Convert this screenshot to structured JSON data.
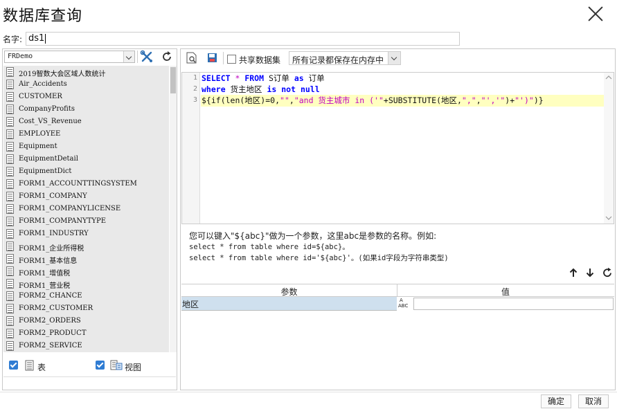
{
  "dialog": {
    "title": "数据库查询"
  },
  "name_field": {
    "label": "名字:",
    "value": "ds1"
  },
  "connection": {
    "selected": "FRDemo"
  },
  "tables": [
    "2019智数大会区域人数统计",
    "Air_Accidents",
    "CUSTOMER",
    "CompanyProfits",
    "Cost_VS_Revenue",
    "EMPLOYEE",
    "Equipment",
    "EquipmentDetail",
    "EquipmentDict",
    "FORM1_ACCOUNTTINGSYSTEM",
    "FORM1_COMPANY",
    "FORM1_COMPANYLICENSE",
    "FORM1_COMPANYTYPE",
    "FORM1_INDUSTRY",
    "FORM1_企业所得税",
    "FORM1_基本信息",
    "FORM1_增值税",
    "FORM1_营业税",
    "FORM2_CHANCE",
    "FORM2_CUSTOMER",
    "FORM2_ORDERS",
    "FORM2_PRODUCT",
    "FORM2_SERVICE"
  ],
  "filters": {
    "table_label": "表",
    "view_label": "视图",
    "table_checked": true,
    "view_checked": true
  },
  "toolbar": {
    "share_label": "共享数据集",
    "memory_option": "所有记录都保存在内存中"
  },
  "editor": {
    "line_numbers": [
      "1",
      "2",
      "3"
    ],
    "line1": {
      "kw1": "SELECT",
      "star": " * ",
      "kw2": "FROM",
      "t1": " S订单 ",
      "kw3": "as",
      "t2": " 订单"
    },
    "line2": {
      "kw1": "where",
      "t1": " 货主地区 ",
      "kw2": "is not null"
    },
    "line3": {
      "t1": "${if(len(地区)=0,",
      "s1": "\"\"",
      "t2": ",",
      "s2": "\"and 货主城市 in ('\"",
      "t3": "+SUBSTITUTE(地区,",
      "s3": "\",\"",
      "t4": ",",
      "s4": "\"','\"",
      "t5": ")+",
      "s5": "\"')\"",
      "t6": ")}"
    }
  },
  "hint": {
    "line1": "您可以键入\"${abc}\"做为一个参数，这里abc是参数的名称。例如:",
    "line2": "select * from table where id=${abc}。",
    "line3": "select * from table where id='${abc}'。(如果id字段为字符串类型)"
  },
  "params": {
    "col_param": "参数",
    "col_value": "值",
    "rows": [
      {
        "name": "地区",
        "type_icon_top": "A",
        "type_icon_bottom": "ABC",
        "value": ""
      }
    ]
  },
  "buttons": {
    "ok": "确定",
    "cancel": "取消"
  }
}
